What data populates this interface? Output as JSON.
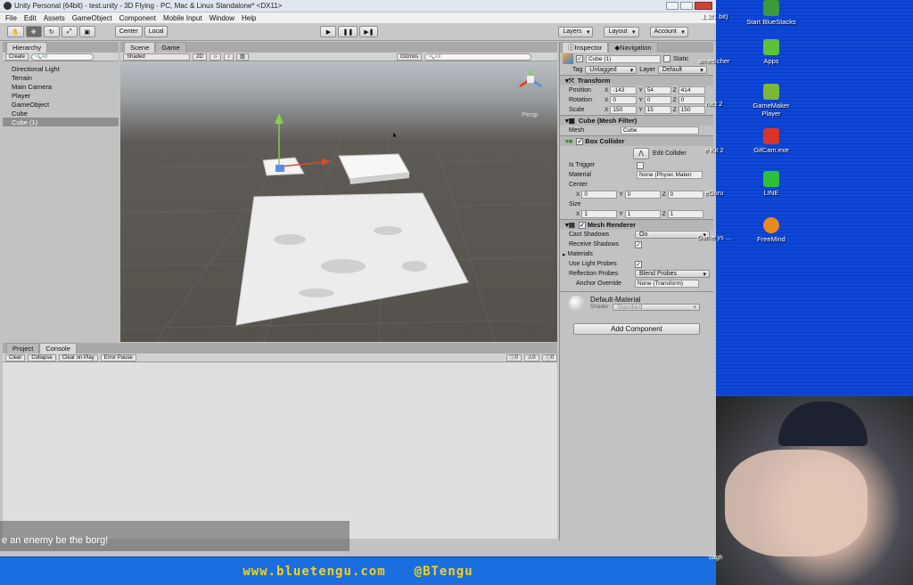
{
  "window": {
    "title": "Unity Personal (64bit) - test.unity - 3D Flying - PC, Mac & Linux Standalone* <DX11>"
  },
  "menu": [
    "File",
    "Edit",
    "Assets",
    "GameObject",
    "Component",
    "Mobile Input",
    "Window",
    "Help"
  ],
  "toolbar": {
    "center": "Center",
    "local": "Local",
    "layers": "Layers",
    "layout": "Layout",
    "account": "Account"
  },
  "hierarchy": {
    "tab": "Hierarchy",
    "create": "Create",
    "search": "All",
    "items": [
      "Directional Light",
      "Terrain",
      "Main Camera",
      "Player",
      "GameObject",
      "Cube",
      "Cube (1)"
    ]
  },
  "scene": {
    "tab_scene": "Scene",
    "tab_game": "Game",
    "shaded": "Shaded",
    "mode2d": "2D",
    "gizmos": "Gizmos",
    "search": "All",
    "persp": "Persp"
  },
  "inspector": {
    "tab": "Inspector",
    "nav_tab": "Navigation",
    "name": "Cube (1)",
    "static": "Static",
    "tag_label": "Tag",
    "tag": "Untagged",
    "layer_label": "Layer",
    "layer": "Default",
    "transform": {
      "title": "Transform",
      "pos_label": "Position",
      "rot_label": "Rotation",
      "scale_label": "Scale",
      "position": [
        "-143",
        "54",
        "414"
      ],
      "rotation": [
        "0",
        "0",
        "0"
      ],
      "scale": [
        "150",
        "15",
        "150"
      ]
    },
    "mesh_filter": {
      "title": "Cube (Mesh Filter)",
      "mesh_label": "Mesh",
      "mesh": "Cube"
    },
    "box_collider": {
      "title": "Box Collider",
      "edit": "Edit Collider",
      "is_trigger": "Is Trigger",
      "material_label": "Material",
      "material": "None (Physic Materi",
      "center_label": "Center",
      "center": [
        "0",
        "0",
        "0"
      ],
      "size_label": "Size",
      "size": [
        "1",
        "1",
        "1"
      ]
    },
    "mesh_renderer": {
      "title": "Mesh Renderer",
      "cast_label": "Cast Shadows",
      "cast": "On",
      "receive": "Receive Shadows",
      "materials": "Materials",
      "light_probes": "Use Light Probes",
      "refl_label": "Reflection Probes",
      "refl": "Blend Probes",
      "anchor_label": "Anchor Override",
      "anchor": "None (Transform)"
    },
    "material": {
      "name": "Default-Material",
      "shader_label": "Shader",
      "shader": "Standard"
    },
    "add_component": "Add Component"
  },
  "console": {
    "tab_project": "Project",
    "tab_console": "Console",
    "buttons": [
      "Clear",
      "Collapse",
      "Clear on Play",
      "Error Pause"
    ],
    "counts": [
      "0",
      "0",
      "0"
    ]
  },
  "subtitle": "e an enemy be the borg!",
  "footer": {
    "site": "www.bluetengu.com",
    "handle": "@BTengu"
  },
  "desktop": {
    "icons": [
      "Start BlueStacks",
      "Apps",
      "GameMaker Player",
      "GifCam.exe",
      "LINE",
      "FreeMind"
    ],
    "partial": [
      ".1.2f1 bit)",
      "ames cher",
      "ruct 2",
      "e Kit 2",
      "eGuru",
      "Game ys ...",
      "oagh"
    ]
  }
}
